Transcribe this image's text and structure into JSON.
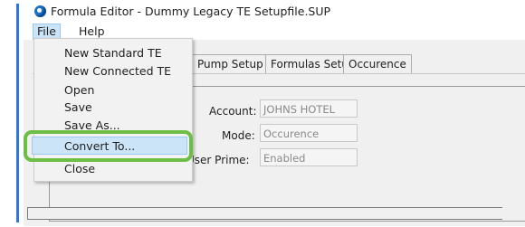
{
  "window": {
    "title": "Formula Editor - Dummy Legacy TE Setupfile.SUP"
  },
  "menubar": {
    "file": "File",
    "help": "Help"
  },
  "file_menu": {
    "items": [
      "New Standard TE",
      "New Connected TE",
      "Open",
      "Save",
      "Save As...",
      "Convert To...",
      "Close"
    ],
    "highlighted": "Convert To..."
  },
  "tabs": [
    "Pump Setup",
    "Formulas Setup",
    "Occurence"
  ],
  "form": {
    "account_label": "Account:",
    "account_value": "JOHNS HOTEL",
    "mode_label": "Mode:",
    "mode_value": "Occurence",
    "user_prime_label": "User Prime:",
    "user_prime_value": "Enabled"
  },
  "colors": {
    "highlight_ring": "#6ebd44",
    "selected_item": "#cce4f7",
    "left_accent": "#2f75d6"
  }
}
